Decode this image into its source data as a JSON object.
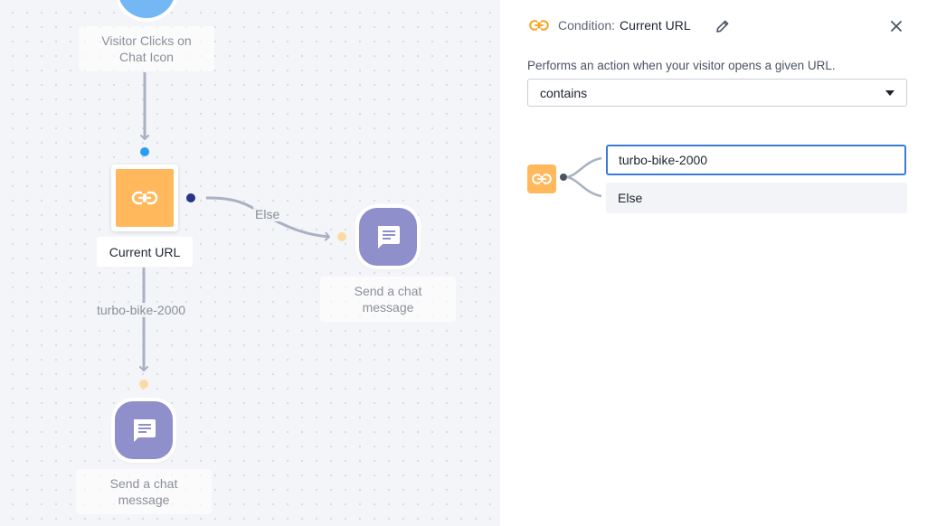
{
  "canvas": {
    "trigger_node": {
      "label": "Visitor Clicks on Chat Icon"
    },
    "condition_node": {
      "label": "Current URL",
      "icon": "link-icon"
    },
    "else_edge_label": "Else",
    "match_edge_label": "turbo-bike-2000",
    "send_node_right": {
      "label": "Send a chat message",
      "icon": "chat-message-icon"
    },
    "send_node_bottom": {
      "label": "Send a chat message",
      "icon": "chat-message-icon"
    }
  },
  "panel": {
    "condition_label": "Condition:",
    "condition_name": "Current URL",
    "description": "Performs an action when your visitor opens a given URL.",
    "operator": {
      "selected": "contains"
    },
    "branches": {
      "match_value": "turbo-bike-2000",
      "else_label": "Else"
    }
  },
  "colors": {
    "condition_orange": "#ffb85c",
    "chat_purple": "#8f8fcc",
    "trigger_blue": "#73b8f5",
    "focus_blue": "#3a7bd5",
    "canvas_bg": "#f3f5f8"
  }
}
